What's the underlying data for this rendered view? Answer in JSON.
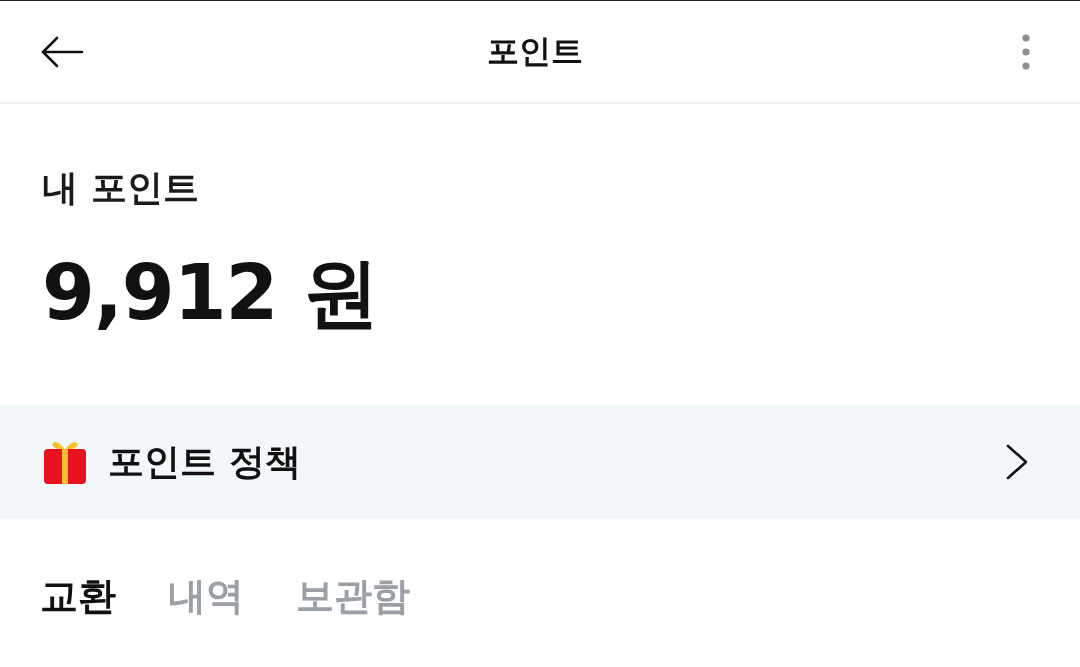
{
  "header": {
    "title": "포인트"
  },
  "balance": {
    "label": "내 포인트",
    "amount": "9,912 원"
  },
  "policy_banner": {
    "label": "포인트 정책"
  },
  "tabs": [
    {
      "label": "교환",
      "selected": true
    },
    {
      "label": "내역",
      "selected": false
    },
    {
      "label": "보관함",
      "selected": false
    }
  ]
}
